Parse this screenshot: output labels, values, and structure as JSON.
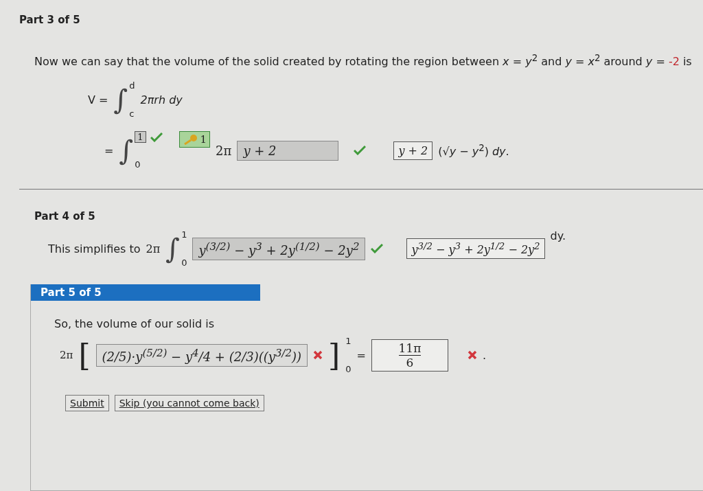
{
  "part3": {
    "title": "Part 3 of 5",
    "sentence": [
      {
        "kind": "plain",
        "text": "Now we can say that the volume of the solid created by rotating the region between *x* = *y*$^{2}$ and *y* = *x*$^{2}$ around *y* = "
      },
      {
        "kind": "highlight",
        "text": "-2"
      },
      {
        "kind": "plain",
        "text": " is"
      }
    ],
    "formula": {
      "lhs": "V =",
      "integral": "∫",
      "upper": "d",
      "lower": "c",
      "integrand": "2πrh dy"
    },
    "step": {
      "equals": "=",
      "integral": "∫",
      "lower": "0",
      "upper_field": {
        "value": "1",
        "correct": true
      },
      "hint": {
        "value": "1"
      },
      "factor": "2π",
      "radius_field": {
        "value": "y + 2",
        "correct": true
      },
      "preview": "*y* + 2",
      "rest": "(√*y* − *y*$^{2}$) *dy*."
    }
  },
  "part4": {
    "title": "Part 4 of 5",
    "lead": "This simplifies to",
    "factor": "2π",
    "integral": "∫",
    "upper": "1",
    "lower": "0",
    "field": {
      "value": "y$^{(3/2)}$ − y$^{3}$ + 2y$^{(1/2)}$ − 2y$^{2}$",
      "correct": true
    },
    "preview": "y$^{3/2}$ − y$^{3}$ + 2y$^{1/2}$ − 2y$^{2}$",
    "tail": "dy."
  },
  "part5": {
    "title": "Part 5 of 5",
    "lead": "So, the volume of our solid is",
    "factor": "2π",
    "open_bracket": "[",
    "field": {
      "value": "(2/5)·*y*$^{(5/2)}$ − *y*$^{4}$/4 + (2/3)((*y*$^{3/2}$))",
      "correct": false
    },
    "close_bracket": "]",
    "upper": "1",
    "lower": "0",
    "equals": "=",
    "answer": {
      "numerator": "11π",
      "denominator": "6",
      "correct": false
    },
    "period": "."
  },
  "buttons": [
    "Submit",
    "Skip (you cannot come back)"
  ]
}
